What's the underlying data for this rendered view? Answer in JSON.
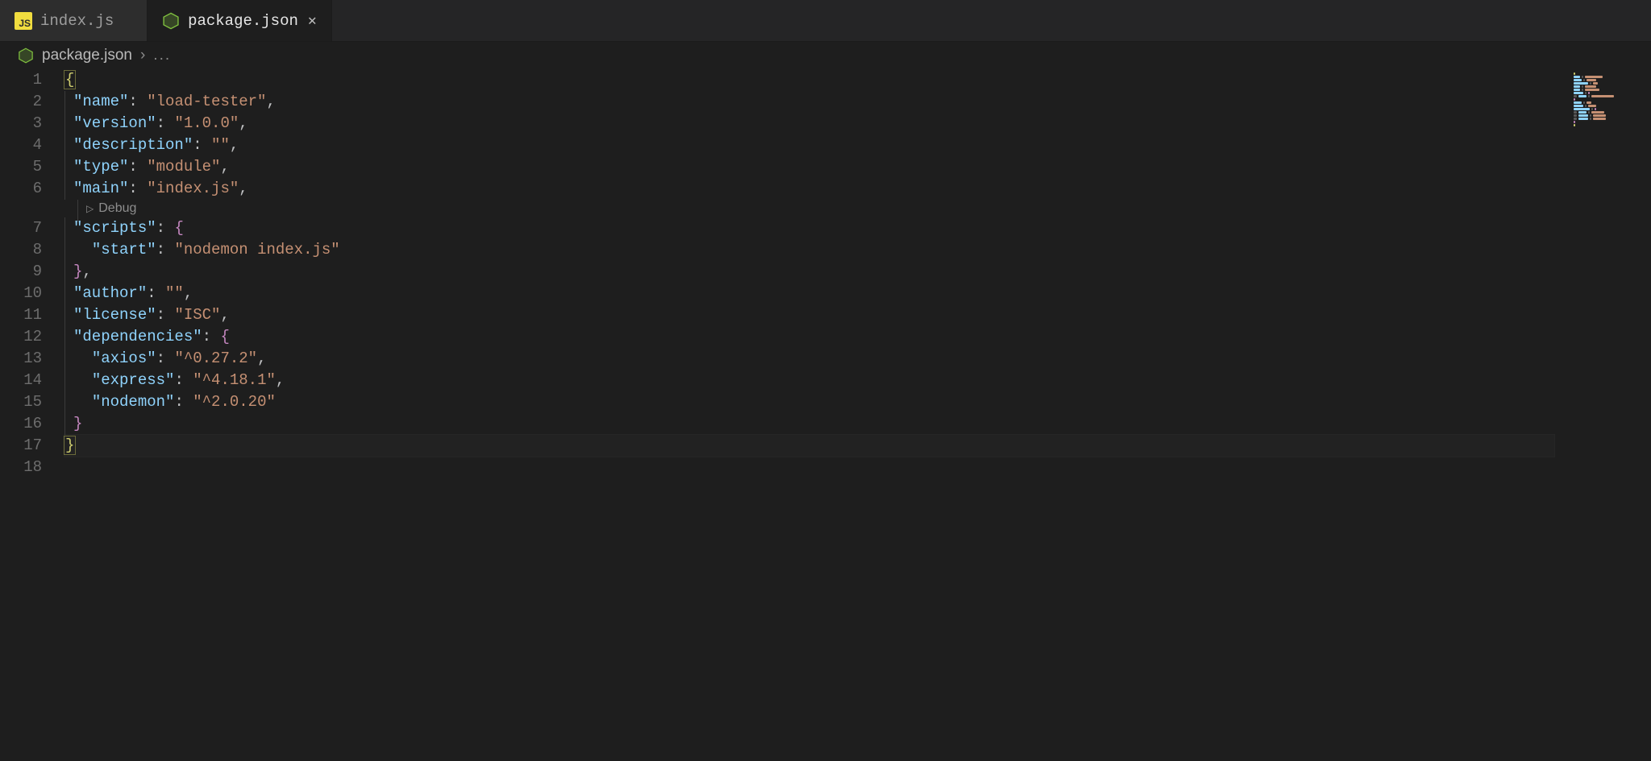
{
  "tabs": [
    {
      "icon": "js",
      "label": "index.js",
      "active": false,
      "dirty": false
    },
    {
      "icon": "node",
      "label": "package.json",
      "active": true,
      "dirty": false
    }
  ],
  "breadcrumb": {
    "icon": "node",
    "file": "package.json",
    "more": "..."
  },
  "codelens": {
    "debug": "Debug"
  },
  "colors": {
    "key": "#8fd3fc",
    "str": "#c59073",
    "punc": "#bfc0c2",
    "brace": "#d0cf70",
    "brace2": "#c486bf",
    "accent": "#1e1e1e"
  },
  "file": {
    "name": "load-tester",
    "version": "1.0.0",
    "description": "",
    "type": "module",
    "main": "index.js",
    "scripts": {
      "start": "nodemon index.js"
    },
    "author": "",
    "license": "ISC",
    "dependencies": {
      "axios": "^0.27.2",
      "express": "^4.18.1",
      "nodemon": "^2.0.20"
    }
  },
  "editor": {
    "line_count": 18,
    "cursor_line": 17
  }
}
